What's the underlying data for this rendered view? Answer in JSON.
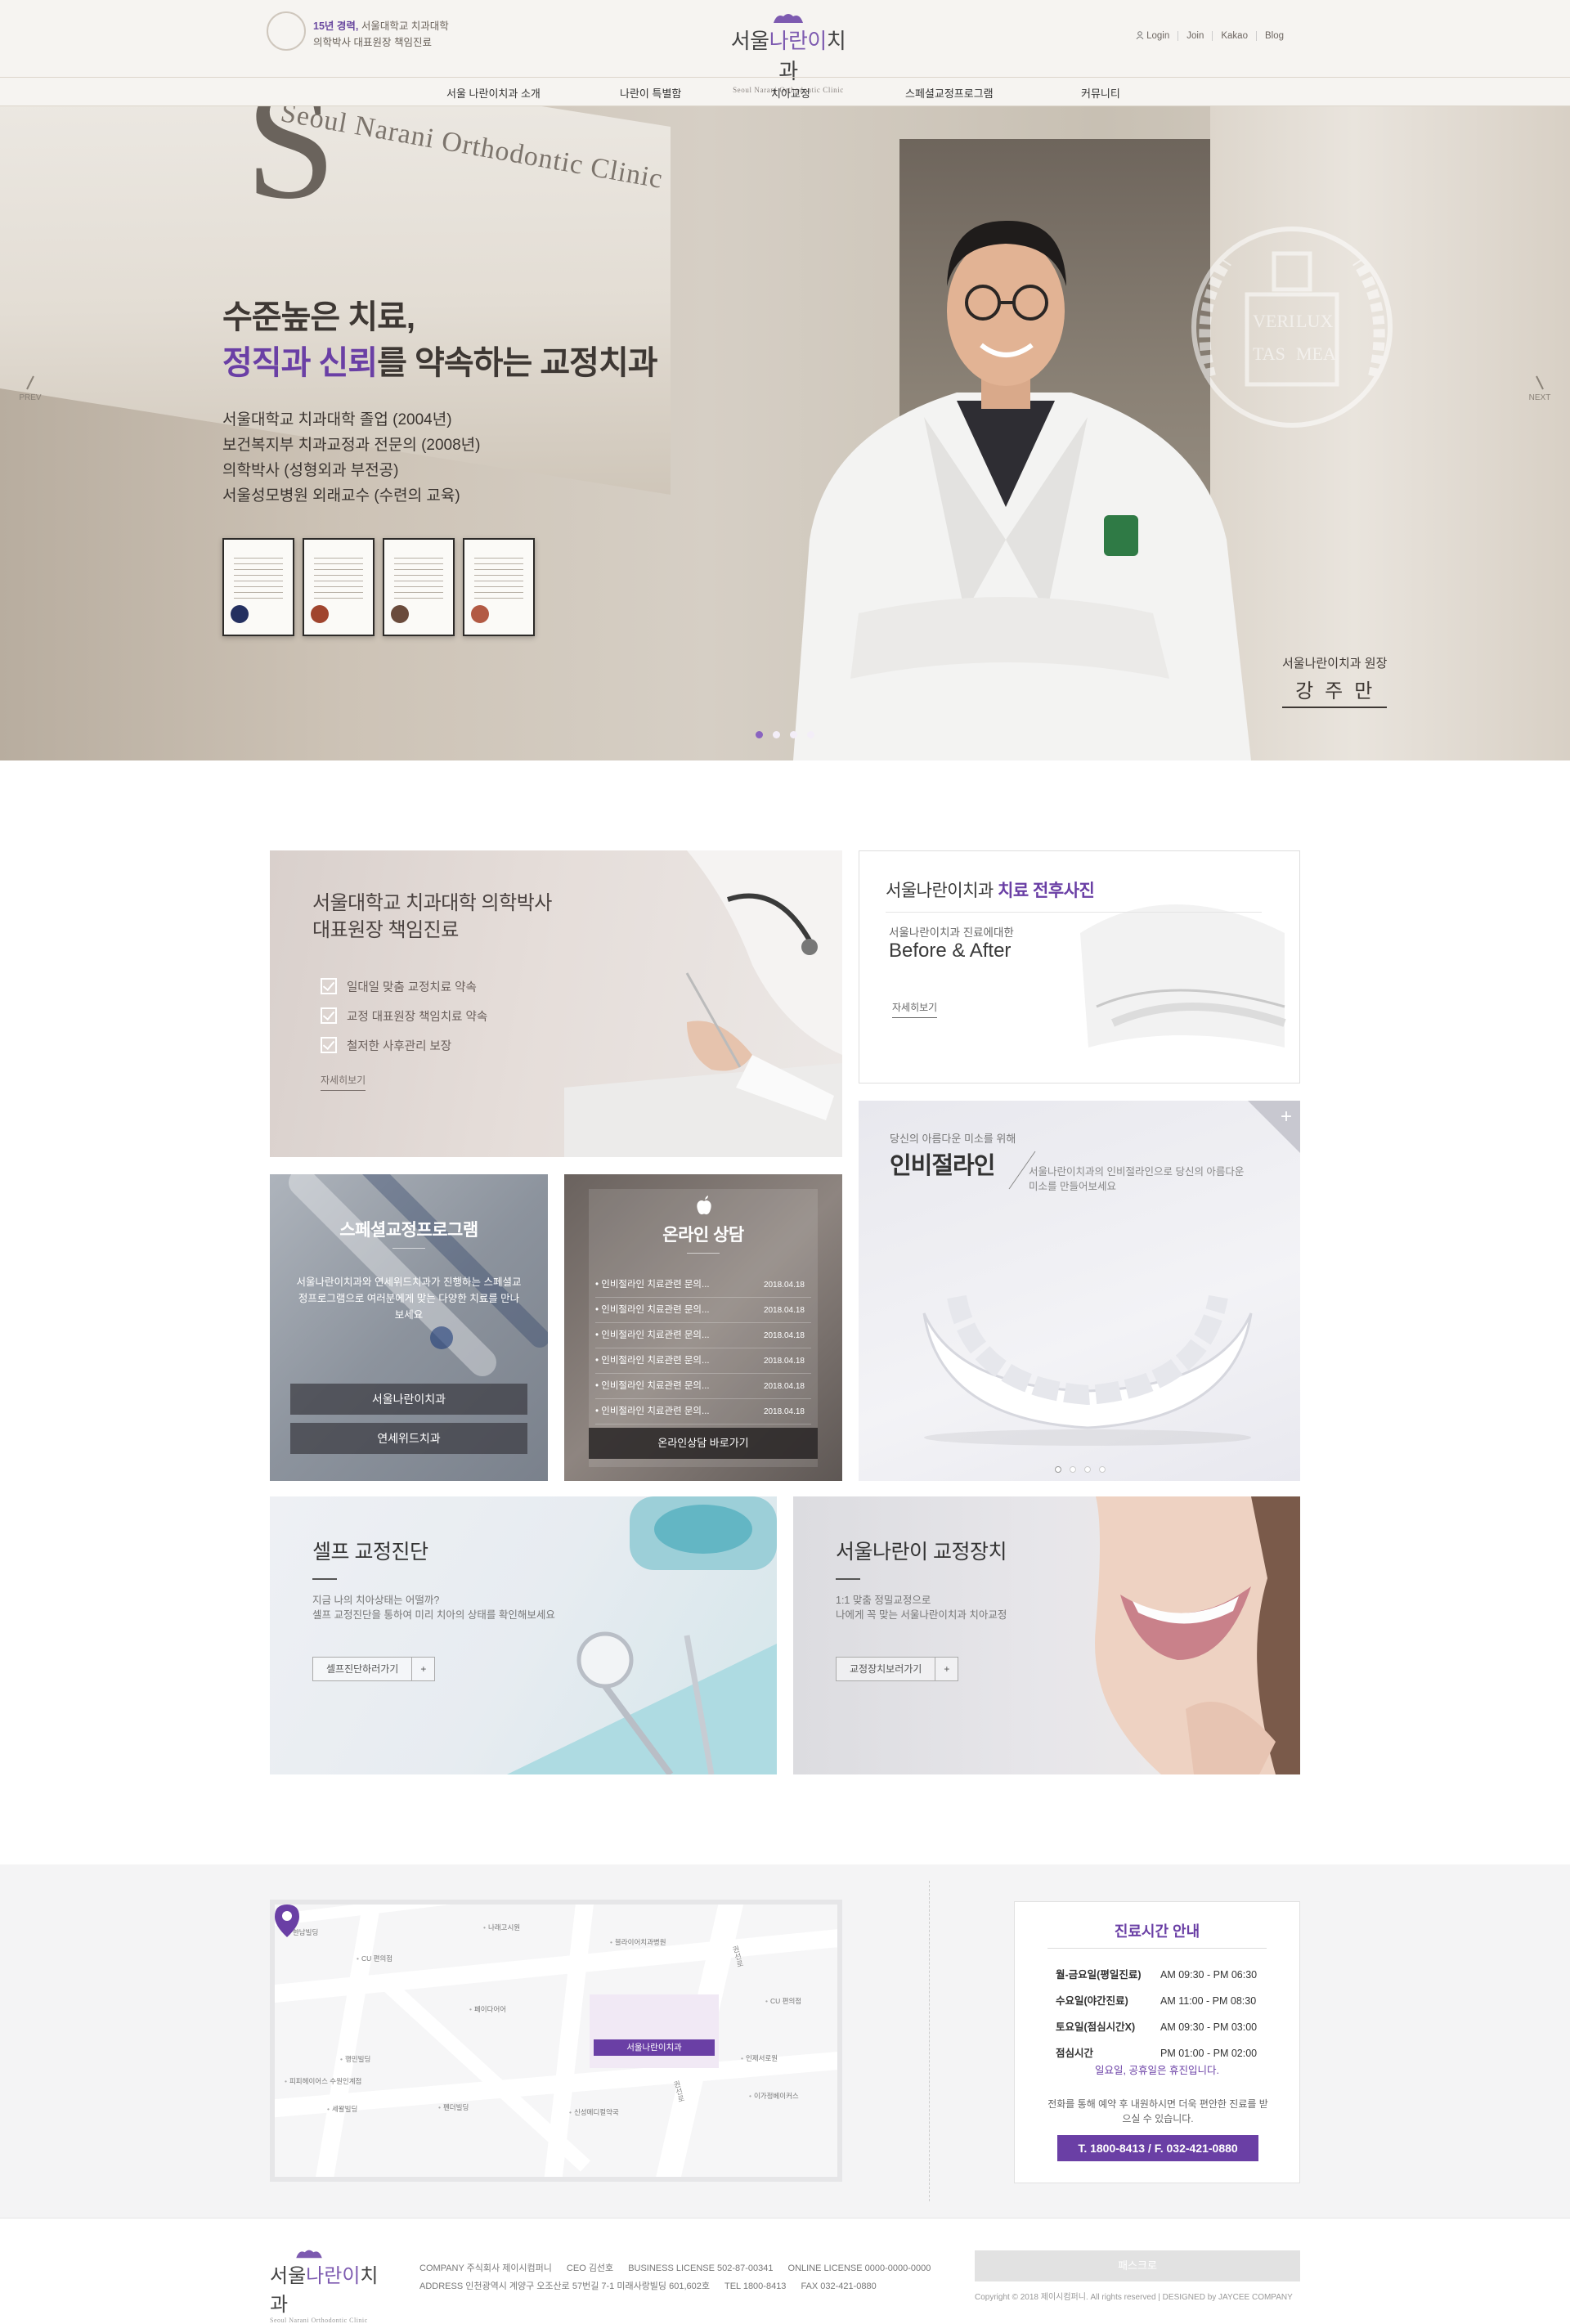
{
  "header": {
    "experience_highlight": "15년 경력,",
    "experience_rest": " 서울대학교 치과대학",
    "experience_line2": "의학박사 대표원장 책임진료",
    "logo_main_a": "서울",
    "logo_main_b": "나란이",
    "logo_main_c": "치과",
    "logo_sub": "Seoul Narani Orthodontic Clinic",
    "util": [
      "Login",
      "Join",
      "Kakao",
      "Blog"
    ],
    "nav": [
      "서울 나란이치과 소개",
      "나란이 특별함",
      "치아교정",
      "스페셜교정프로그램",
      "커뮤니티"
    ]
  },
  "hero": {
    "sign_text": "Seoul Narani Orthodontic Clinic",
    "headline_1": "수준높은 치료,",
    "headline_2_hl": "정직과 신뢰",
    "headline_2_rest": "를 약속하는 교정치과",
    "credentials": [
      "서울대학교 치과대학 졸업 (2004년)",
      "보건복지부 치과교정과 전문의 (2008년)",
      "의학박사 (성형외과 부전공)",
      "서울성모병원 외래교수 (수련의 교육)"
    ],
    "director_title": "서울나란이치과 원장",
    "director_name": "강주만",
    "prev_label": "PREV",
    "next_label": "NEXT",
    "slide_count": 4,
    "active_slide": 1,
    "seal_text": [
      "VERI",
      "LUX",
      "TAS",
      "MEA"
    ]
  },
  "cards": {
    "doctor": {
      "title_1": "서울대학교 치과대학 의학박사",
      "title_2": "대표원장 책임진료",
      "points": [
        "일대일 맞춤 교정치료 약속",
        "교정 대표원장 책임치료 약속",
        "철저한 사후관리 보장"
      ],
      "more": "자세히보기"
    },
    "before_after": {
      "title_a": "서울나란이치과 ",
      "title_b": "치료 전후사진",
      "sub": "서울나란이치과 진료에대한",
      "big": "Before & After",
      "more": "자세히보기"
    },
    "special": {
      "title": "스페셜교정프로그램",
      "desc": "서울나란이치과와 연세위드치과가 진행하는 스페셜교정프로그램으로 여러분에게 맞는 다양한 치료를 만나보세요",
      "btn_1": "서울나란이치과",
      "btn_2": "연세위드치과"
    },
    "consult": {
      "title": "온라인 상담",
      "rows": [
        {
          "text": "인비절라인 치료관련 문의...",
          "date": "2018.04.18"
        },
        {
          "text": "인비절라인 치료관련 문의...",
          "date": "2018.04.18"
        },
        {
          "text": "인비절라인 치료관련 문의...",
          "date": "2018.04.18"
        },
        {
          "text": "인비절라인 치료관련 문의...",
          "date": "2018.04.18"
        },
        {
          "text": "인비절라인 치료관련 문의...",
          "date": "2018.04.18"
        },
        {
          "text": "인비절라인 치료관련 문의...",
          "date": "2018.04.18"
        }
      ],
      "btn": "온라인상담 바로가기"
    },
    "invisalign": {
      "sub": "당신의 아름다운 미소를 위해",
      "title": "인비절라인",
      "desc_1": "서울나란이치과의 인비절라인으로 당신의 아름다운",
      "desc_2": "미소를 만들어보세요",
      "plus": "+",
      "slide_count": 4
    },
    "self_check": {
      "title": "셀프 교정진단",
      "desc_1": "지금 나의 치아상태는 어떨까?",
      "desc_2": "셀프 교정진단을 통하여 미리 치아의 상태를 확인해보세요",
      "btn": "셀프진단하러가기",
      "plus": "+"
    },
    "appliance": {
      "title": "서울나란이 교정장치",
      "desc_1": "1:1 맞춤 정밀교정으로",
      "desc_2": "나에게 꼭 맞는 서울나란이치과 치아교정",
      "btn": "교정장치보러가기",
      "plus": "+"
    }
  },
  "map": {
    "pin_label": "서울나란이치과",
    "labels": [
      "한남빌딩",
      "CU 편의점",
      "나래고시원",
      "블라이어치과병원",
      "페이다어어",
      "CU 편의점",
      "행민빌딩",
      "인제서로원",
      "피피헤이어스 수원인계점",
      "세왈빌딩",
      "펜더빌딩",
      "이가정베이커스",
      "신성메디컬약국"
    ],
    "roads": [
      "권선로",
      "권선로"
    ]
  },
  "hours": {
    "title": "진료시간 안내",
    "rows": [
      {
        "day": "월-금요일(평일진료)",
        "time": "AM 09:30 - PM 06:30"
      },
      {
        "day": "수요일(야간진료)",
        "time": "AM 11:00 - PM 08:30"
      },
      {
        "day": "토요일(점심시간X)",
        "time": "AM 09:30 - PM 03:00"
      },
      {
        "day": "점심시간",
        "time": "PM 01:00 - PM 02:00"
      }
    ],
    "holiday": "일요일, 공휴일은 휴진입니다.",
    "note": "전화를 통해 예약 후 내원하시면 더욱 편안한 진료를 받으실 수 있습니다.",
    "tel": "T. 1800-8413 / F. 032-421-0880"
  },
  "footer": {
    "logo_a": "서울",
    "logo_b": "나란이",
    "logo_c": "치과",
    "logo_sub": "Seoul Narani Orthodontic Clinic",
    "line1": [
      "COMPANY 주식회사 제이시컴퍼니",
      "CEO 김선호",
      "BUSINESS LICENSE 502-87-00341",
      "ONLINE LICENSE 0000-0000-0000"
    ],
    "line2": [
      "ADDRESS 인천광역시 계양구 오조산로 57번길 7-1 미래사랑빌딩 601,602호",
      "TEL 1800-8413",
      "FAX 032-421-0880"
    ],
    "box": "패스크로",
    "copyright": "Copyright © 2018 제이시컴퍼니. All rights reserved | DESIGNED by JAYCEE COMPANY"
  },
  "colors": {
    "accent": "#6a3fa5",
    "hero_bg": "#cdc3b6",
    "info_bg": "#f4f4f5"
  }
}
